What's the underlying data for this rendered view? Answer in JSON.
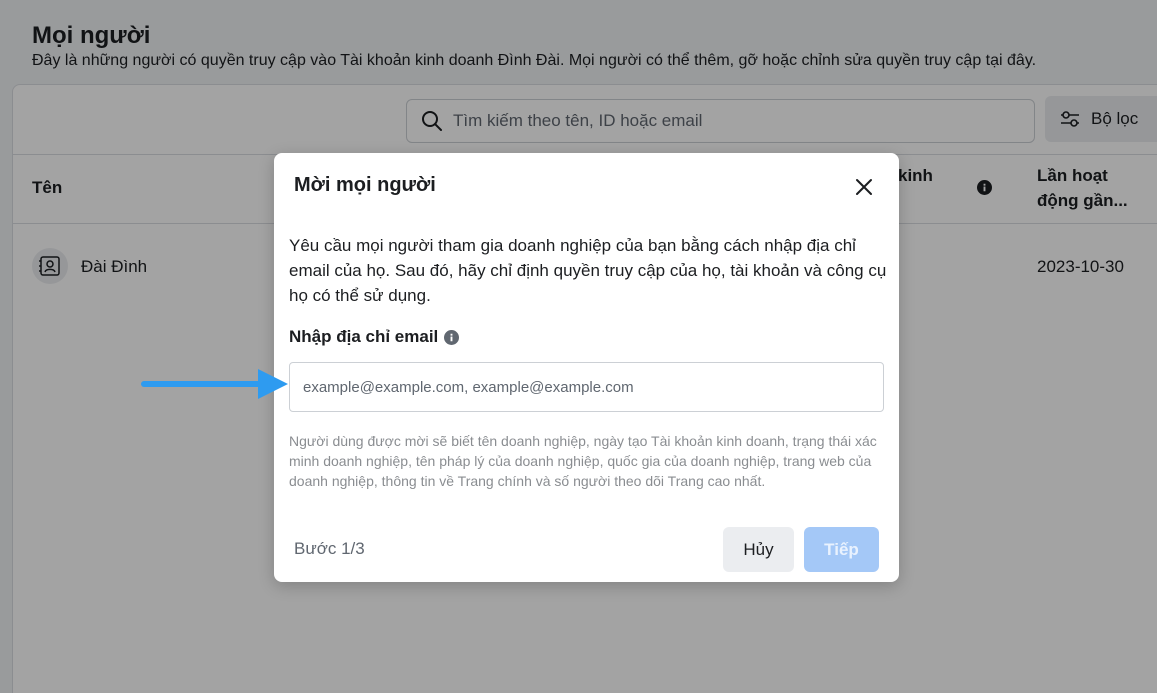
{
  "page": {
    "title": "Mọi người",
    "description": "Đây là những người có quyền truy cập vào Tài khoản kinh doanh Đình Đài. Mọi người có thể thêm, gỡ hoặc chỉnh sửa quyền truy cập tại đây."
  },
  "search": {
    "placeholder": "Tìm kiếm theo tên, ID hoặc email",
    "icon": "search-icon"
  },
  "filter": {
    "label": "Bộ lọc",
    "icon": "sliders-icon"
  },
  "table": {
    "headers": {
      "name": "Tên",
      "business_partial": "kinh",
      "last_active_line1": "Lần hoạt",
      "last_active_line2": "động gần..."
    },
    "rows": [
      {
        "name": "Đài Đình",
        "last_active": "2023-10-30",
        "icon": "contact-card-icon"
      }
    ]
  },
  "modal": {
    "title": "Mời mọi người",
    "intro": "Yêu cầu mọi người tham gia doanh nghiệp của bạn bằng cách nhập địa chỉ email của họ. Sau đó, hãy chỉ định quyền truy cập của họ, tài khoản và công cụ họ có thể sử dụng.",
    "email_label": "Nhập địa chỉ email",
    "email_placeholder": "example@example.com, example@example.com",
    "email_value": "",
    "notice": "Người dùng được mời sẽ biết tên doanh nghiệp, ngày tạo Tài khoản kinh doanh, trạng thái xác minh doanh nghiệp, tên pháp lý của doanh nghiệp, quốc gia của doanh nghiệp, trang web của doanh nghiệp, thông tin về Trang chính và số người theo dõi Trang cao nhất.",
    "step": "Bước 1/3",
    "cancel_label": "Hủy",
    "next_label": "Tiếp"
  },
  "colors": {
    "arrow": "#2e9bf0",
    "next_disabled": "#a4c8f7"
  }
}
